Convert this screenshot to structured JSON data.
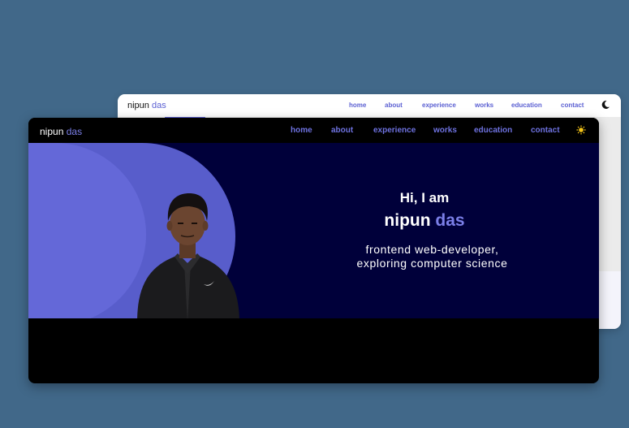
{
  "back_window": {
    "brand": {
      "first": "nipun",
      "last": "das"
    },
    "nav": [
      "home",
      "about",
      "experience",
      "works",
      "education",
      "contact"
    ],
    "theme_toggle_icon": "moon-icon"
  },
  "front_window": {
    "brand": {
      "first": "nipun",
      "last": "das"
    },
    "nav": [
      "home",
      "about",
      "experience",
      "works",
      "education",
      "contact"
    ],
    "theme_toggle_icon": "sun-icon",
    "hero": {
      "greeting": "Hi, I am",
      "name_first": "nipun",
      "name_last": "das",
      "tagline_line1": "frontend web-developer,",
      "tagline_line2": "exploring computer science"
    }
  },
  "colors": {
    "page_bg": "#416889",
    "accent": "#5a5fd2",
    "hero_bg": "#00003a",
    "dark_bg": "#000000"
  }
}
